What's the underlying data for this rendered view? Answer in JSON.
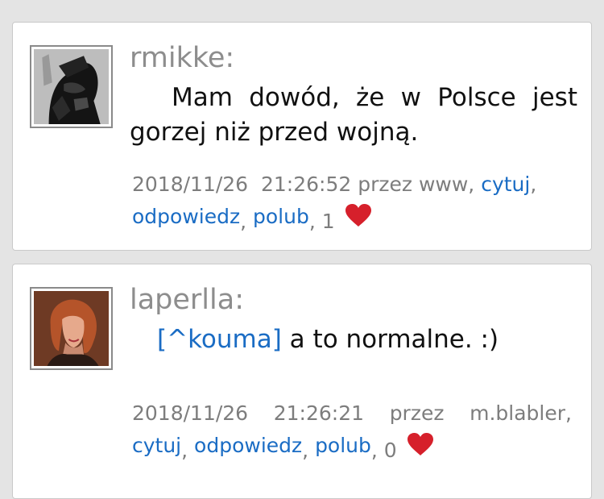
{
  "comments": [
    {
      "username": "rmikke:",
      "text": "Mam dowód, że w Polsce jest gorzej niż przed wojną.",
      "date": "2018/11/26",
      "time": "21:26:52",
      "via": "przez www,",
      "actions": {
        "quote": "cytuj",
        "reply": "odpowiedz",
        "like": "polub"
      },
      "likes": "1"
    },
    {
      "username": "laperlla:",
      "mention": "[^kouma]",
      "text": " a to normalne. :)",
      "date": "2018/11/26",
      "time": "21:26:21",
      "via_word": "przez",
      "via_name": "m.blabler,",
      "actions": {
        "quote": "cytuj",
        "reply": "odpowiedz",
        "like": "polub"
      },
      "likes": "0"
    }
  ],
  "colors": {
    "link": "#1a6cc4",
    "heart": "#d6202b",
    "username": "#8d8d8d"
  },
  "icons": [
    "avatar-rmikke",
    "avatar-laperlla",
    "heart-icon"
  ]
}
